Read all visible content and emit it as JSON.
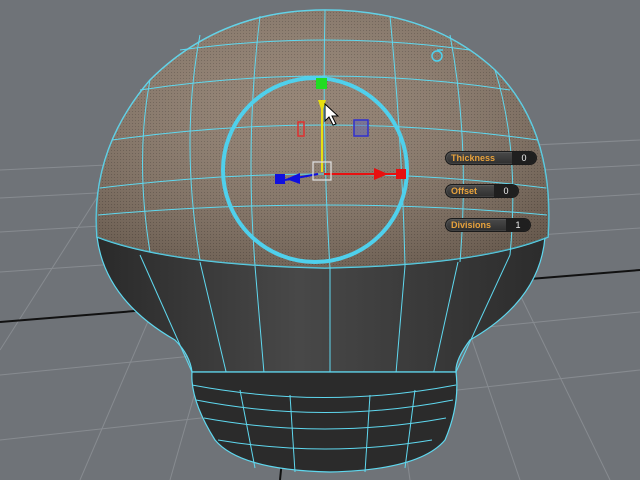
{
  "viewport": {
    "background_color": "#6f7378",
    "wireframe_color": "#5fd8ef",
    "grid_color": "#8a8e93",
    "axis_line_color": "#111111"
  },
  "mesh": {
    "dome_color": "#8b7a6a",
    "base_color": "#3a3a3a"
  },
  "manipulator": {
    "ring_color": "#4fd0ec",
    "x_axis_color": "#e81010",
    "y_axis_color": "#e8e010",
    "z_axis_color": "#1010e0",
    "center_handle_color": "#22dd22"
  },
  "hud": {
    "thickness": {
      "label": "Thickness",
      "value": "0"
    },
    "offset": {
      "label": "Offset",
      "value": "0"
    },
    "divisions": {
      "label": "Divisions",
      "value": "1"
    }
  },
  "icons": {
    "pivot": "pivot-icon",
    "cursor": "mouse-pointer-icon"
  }
}
